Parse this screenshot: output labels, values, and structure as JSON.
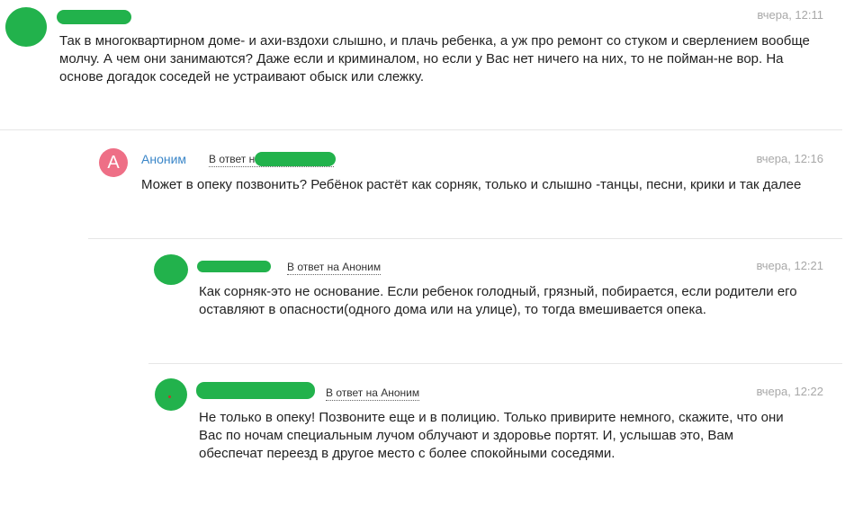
{
  "comments": [
    {
      "author": "",
      "reply_to": "",
      "time": "вчера, 12:11",
      "text": "Так в многоквартирном доме- и ахи-вздохи слышно, и плачь ребенка, а уж про ремонт со стуком и сверлением вообще молчу. А чем они занимаются? Даже если и криминалом, но если у Вас нет ничего на них, то не пойман-не вор. На основе догадок соседей не устраивают обыск или слежку."
    },
    {
      "author": "Аноним",
      "avatar_letter": "А",
      "reply_to": "В ответ на",
      "time": "вчера, 12:16",
      "text": "Может в опеку позвонить? Ребёнок растёт как сорняк, только и слышно -танцы, песни, крики и так далее"
    },
    {
      "author": "",
      "reply_to": "В ответ на Аноним",
      "time": "вчера, 12:21",
      "text": "Как сорняк-это не основание. Если ребенок голодный, грязный, побирается, если родители его оставляют в опасности(одного дома или на улице), то тогда вмешивается опека."
    },
    {
      "author": "",
      "reply_to": "В ответ на Аноним",
      "time": "вчера, 12:22",
      "text": "Не только в опеку! Позвоните еще и в полицию. Только привирите немного, скажите, что они Вас по ночам специальным лучом облучают и здоровье портят. И, услышав это, Вам обеспечат переезд в другое место с более спокойными соседями."
    }
  ],
  "colors": {
    "redaction": "#22b24c",
    "author_link": "#3a86c8",
    "avatar_letter_bg": "#ee6f86",
    "timestamp": "#a8a8a8"
  }
}
